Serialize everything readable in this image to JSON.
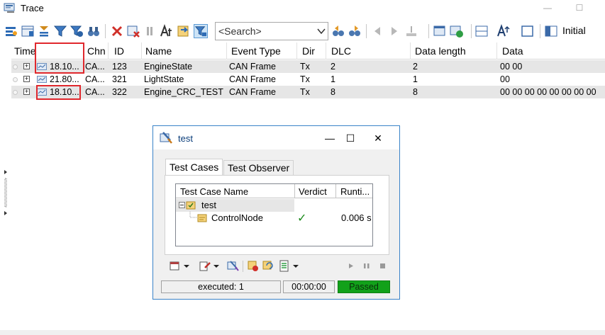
{
  "window": {
    "title": "Trace",
    "minimize": "—",
    "maximize": "☐",
    "close": "✕"
  },
  "toolbar": {
    "search_placeholder": "<Search>",
    "layout_label": "Initial"
  },
  "trace_table": {
    "columns": [
      "Time",
      "Chn",
      "ID",
      "Name",
      "Event Type",
      "Dir",
      "DLC",
      "Data length",
      "Data"
    ],
    "rows": [
      {
        "time": "18.10...",
        "chn": "CA...",
        "id": "123",
        "name": "EngineState",
        "event_type": "CAN Frame",
        "dir": "Tx",
        "dlc": "2",
        "data_length": "2",
        "data": "00  00"
      },
      {
        "time": "21.80...",
        "chn": "CA...",
        "id": "321",
        "name": "LightState",
        "event_type": "CAN Frame",
        "dir": "Tx",
        "dlc": "1",
        "data_length": "1",
        "data": "00"
      },
      {
        "time": "18.10...",
        "chn": "CA...",
        "id": "322",
        "name": "Engine_CRC_TEST",
        "event_type": "CAN Frame",
        "dir": "Tx",
        "dlc": "8",
        "data_length": "8",
        "data": "00  00  00  00  00  00  00  00"
      }
    ]
  },
  "dialog": {
    "title": "test",
    "minimize": "—",
    "maximize": "☐",
    "close": "✕",
    "tabs": [
      "Test Cases",
      "Test Observer"
    ],
    "testcase_columns": [
      "Test Case Name",
      "Verdict",
      "Runti..."
    ],
    "group_name": "test",
    "testcase": {
      "name": "ControlNode",
      "verdict_symbol": "✓",
      "runtime": "0.006 s"
    },
    "status": {
      "executed": "executed: 1",
      "time": "00:00:00",
      "result": "Passed"
    }
  },
  "colors": {
    "highlight": "#e0282d",
    "passed": "#12a11a",
    "dialog_border": "#3a83c8",
    "verdict_pass": "#1a8a1a"
  }
}
